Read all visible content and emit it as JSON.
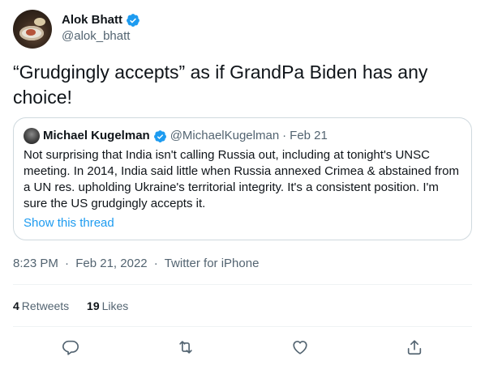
{
  "author": {
    "display_name": "Alok Bhatt",
    "handle": "@alok_bhatt",
    "verified_icon": "verified-badge-icon"
  },
  "tweet": {
    "text": "“Grudgingly accepts” as if GrandPa Biden has any choice!"
  },
  "quoted": {
    "display_name": "Michael Kugelman",
    "handle": "@MichaelKugelman",
    "dot": "·",
    "date": "Feb 21",
    "text": "Not surprising that India isn't calling Russia out, including at tonight's UNSC meeting. In 2014, India said little when Russia annexed Crimea & abstained from a UN res. upholding Ukraine's territorial integrity. It's a consistent position. I'm sure the US grudgingly accepts it.",
    "show_thread": "Show this thread"
  },
  "meta": {
    "time": "8:23 PM",
    "sep1": "·",
    "date": "Feb 21, 2022",
    "sep2": "·",
    "source": "Twitter for iPhone"
  },
  "stats": {
    "retweets_count": "4",
    "retweets_label": "Retweets",
    "likes_count": "19",
    "likes_label": "Likes"
  },
  "colors": {
    "accent": "#1d9bf0",
    "secondary_text": "#536471",
    "border": "#cfd9de"
  },
  "actions": [
    "reply-icon",
    "retweet-icon",
    "like-icon",
    "share-icon"
  ]
}
